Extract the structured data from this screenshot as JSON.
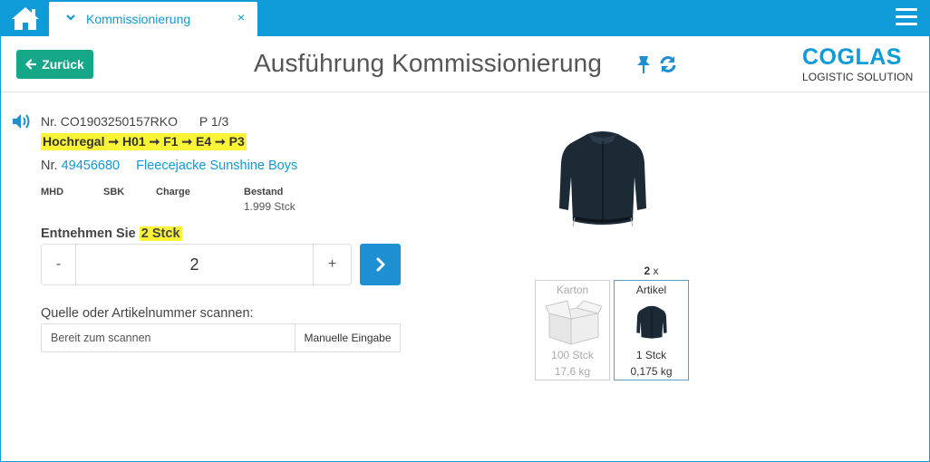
{
  "topbar": {
    "tab_label": "Kommissionierung",
    "tab_close": "×"
  },
  "header": {
    "back_label": "Zurück",
    "title": "Ausführung Kommissionierung",
    "logo_main": "COGLAS",
    "logo_sub": "LOGISTIC SOLUTION"
  },
  "order": {
    "number_label": "Nr.",
    "number": "CO1903250157RKO",
    "position": "P 1/3",
    "route": "Hochregal ➞ H01 ➞ F1 ➞ E4 ➞ P3"
  },
  "article": {
    "number_label": "Nr.",
    "number": "49456680",
    "name": "Fleecejacke Sunshine Boys"
  },
  "attributes": {
    "mhd_label": "MHD",
    "sbk_label": "SBK",
    "charge_label": "Charge",
    "bestand_label": "Bestand",
    "bestand_value": "1.999 Stck"
  },
  "take": {
    "prefix": "Entnehmen Sie",
    "amount": "2 Stck",
    "minus": "-",
    "plus": "+",
    "value": "2"
  },
  "scan": {
    "label": "Quelle oder Artikelnummer scannen:",
    "placeholder": "Bereit zum scannen",
    "manual_label": "Manuelle Eingabe"
  },
  "packaging": {
    "count": "2",
    "count_suffix": "x",
    "karton": {
      "title": "Karton",
      "qty": "100 Stck",
      "weight": "17,6 kg"
    },
    "artikel": {
      "title": "Artikel",
      "qty": "1 Stck",
      "weight": "0,175 kg"
    }
  },
  "colors": {
    "brand_blue": "#0f9bd7",
    "back_green": "#16a789",
    "highlight_yellow": "#fbf436",
    "next_blue": "#1e8fd1"
  },
  "icons": [
    "home-icon",
    "chevron-down-icon",
    "close-icon",
    "menu-icon",
    "arrow-left-icon",
    "pin-icon",
    "refresh-icon",
    "speaker-icon",
    "chevron-right-icon",
    "box-icon"
  ]
}
